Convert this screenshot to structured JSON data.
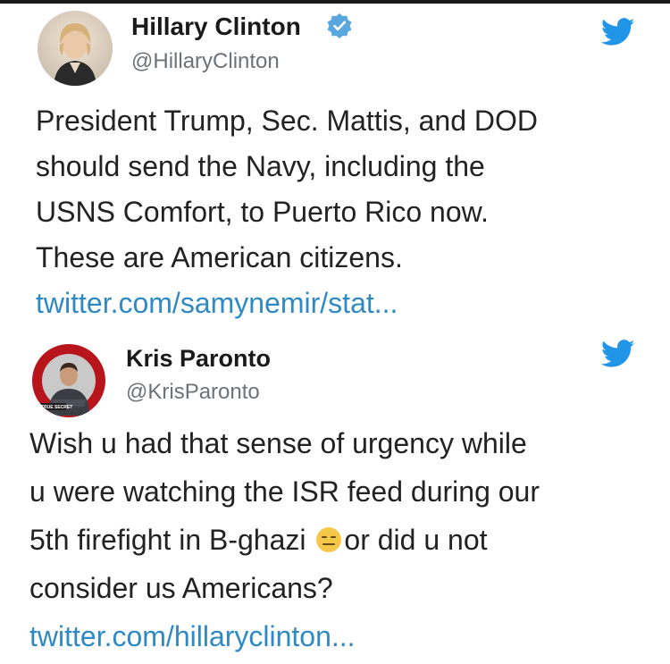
{
  "tweets": [
    {
      "name": "Hillary Clinton",
      "handle": "@HillaryClinton",
      "verified": true,
      "lines": [
        "President Trump, Sec. Mattis, and DOD",
        "should send the Navy, including the",
        "USNS Comfort, to Puerto Rico now.",
        "These are American citizens."
      ],
      "link": "twitter.com/samynemir/stat..."
    },
    {
      "name": "Kris Paronto",
      "handle": "@KrisParonto",
      "avatar_caption": "TRUE SECRET",
      "lines": [
        "Wish u had that sense of urgency while",
        "u were watching the ISR feed during our",
        "5th firefight in B-ghazi",
        "or did u not",
        "consider us Americans?"
      ],
      "link": "twitter.com/hillaryclinton..."
    }
  ],
  "icons": {
    "verified": "verified-badge-icon",
    "bird": "twitter-bird-icon",
    "emoji": "expressionless-face-emoji-icon"
  },
  "colors": {
    "link": "#2f8ac4",
    "twitter_blue": "#1da1f2",
    "handle": "#6c7279",
    "text": "#222222"
  }
}
